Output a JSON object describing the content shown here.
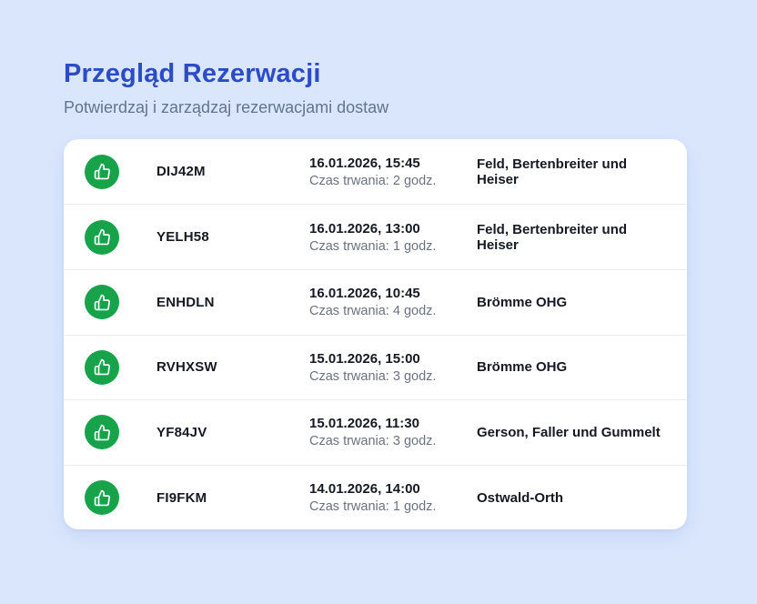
{
  "page": {
    "title": "Przegląd Rezerwacji",
    "subtitle": "Potwierdzaj i zarządzaj rezerwacjami dostaw"
  },
  "colors": {
    "background": "#d9e6fc",
    "title_blue": "#2b4bc7",
    "subtitle_gray": "#64748b",
    "card_white": "#ffffff",
    "confirm_green": "#16a34a",
    "text_primary": "#141922",
    "text_muted": "#6b7280",
    "divider": "#ececf0"
  },
  "icons": {
    "confirm": "thumbs-up-icon"
  },
  "reservations": [
    {
      "code": "DIJ42M",
      "datetime": "16.01.2026, 15:45",
      "duration": "Czas trwania: 2 godz.",
      "company": "Feld, Bertenbreiter und Heiser"
    },
    {
      "code": "YELH58",
      "datetime": "16.01.2026, 13:00",
      "duration": "Czas trwania: 1 godz.",
      "company": "Feld, Bertenbreiter und Heiser"
    },
    {
      "code": "ENHDLN",
      "datetime": "16.01.2026, 10:45",
      "duration": "Czas trwania: 4 godz.",
      "company": "Brömme OHG"
    },
    {
      "code": "RVHXSW",
      "datetime": "15.01.2026, 15:00",
      "duration": "Czas trwania: 3 godz.",
      "company": "Brömme OHG"
    },
    {
      "code": "YF84JV",
      "datetime": "15.01.2026, 11:30",
      "duration": "Czas trwania: 3 godz.",
      "company": "Gerson, Faller und Gummelt"
    },
    {
      "code": "FI9FKM",
      "datetime": "14.01.2026, 14:00",
      "duration": "Czas trwania: 1 godz.",
      "company": "Ostwald-Orth"
    }
  ]
}
